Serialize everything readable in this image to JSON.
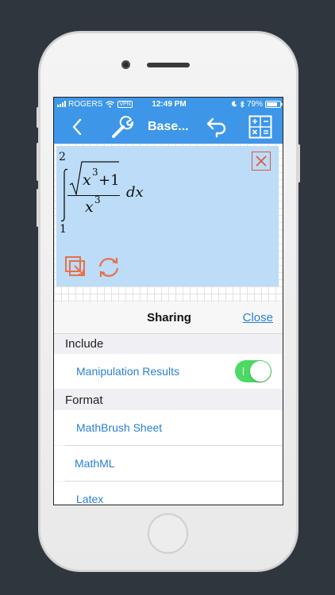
{
  "status_bar": {
    "carrier": "ROGERS",
    "vpn": "VPN",
    "time": "12:49 PM",
    "battery": "79%",
    "battery_level": 0.79
  },
  "toolbar": {
    "title": "Base...",
    "icons": [
      "back-chevron-icon",
      "wrench-icon",
      "undo-arrow-icon",
      "calculator-icon"
    ]
  },
  "math": {
    "upper_limit": "2",
    "lower_limit": "1",
    "radicand_base": "x",
    "radicand_exp": "3",
    "radicand_tail": "+1",
    "denominator_base": "x",
    "denominator_exp": "3",
    "differential": "dx"
  },
  "sheet": {
    "title": "Sharing",
    "close_label": "Close",
    "include_header": "Include",
    "manipulation_label": "Manipulation Results",
    "manipulation_enabled": true,
    "format_header": "Format",
    "formats": [
      "MathBrush Sheet",
      "MathML",
      "Latex"
    ]
  },
  "colors": {
    "accent": "#3d96e8",
    "link": "#2a7fd6",
    "toggle_on": "#4cd964",
    "math_bg": "#bcdcf7",
    "close_red": "#e0563c",
    "tool_orange": "#e8704a"
  }
}
